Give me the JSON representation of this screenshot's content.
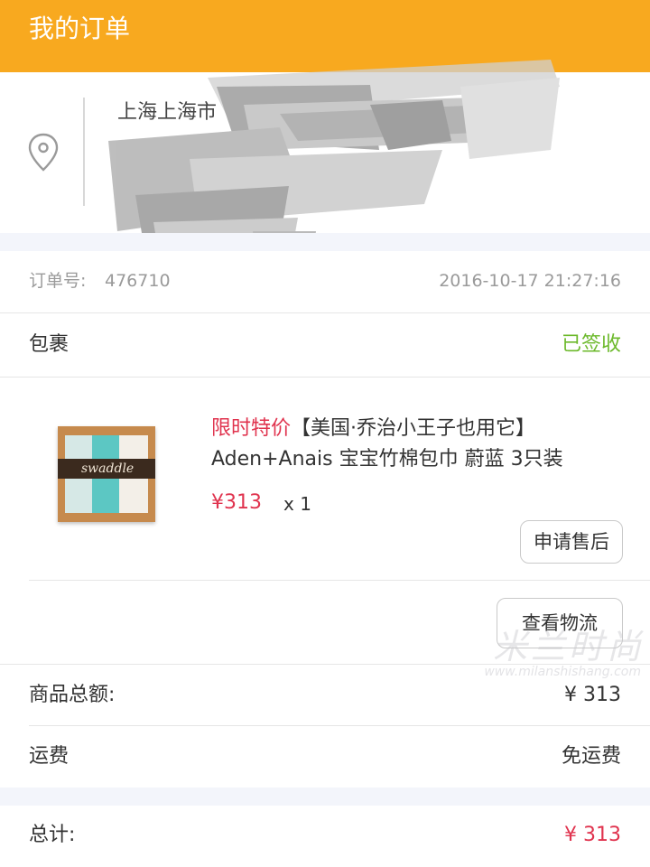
{
  "header": {
    "title": "我的订单"
  },
  "address": {
    "line1": "上海上海市"
  },
  "order": {
    "label": "订单号:",
    "number": "476710",
    "time": "2016-10-17 21:27:16"
  },
  "package": {
    "label": "包裹",
    "status": "已签收"
  },
  "product": {
    "promo_tag": "限时特价",
    "title": "【美国·乔治小王子也用它】Aden+Anais 宝宝竹棉包巾 蔚蓝 3只装",
    "price": "¥313",
    "qty": "x 1",
    "thumb_text": "swaddle",
    "after_sales_button": "申请售后"
  },
  "logistics_button": "查看物流",
  "summary": {
    "goods_total_label": "商品总额:",
    "goods_total_value": "¥ 313",
    "shipping_label": "运费",
    "shipping_value": "免运费",
    "total_label": "总计:",
    "total_value": "¥ 313"
  },
  "watermark": {
    "main": "米兰时尚",
    "sub": "www.milanshishang.com"
  },
  "colors": {
    "header": "#f8a91f",
    "accent_red": "#e0334e",
    "status_green": "#6cb92b"
  },
  "icons": {
    "location": "location-pin-icon"
  }
}
